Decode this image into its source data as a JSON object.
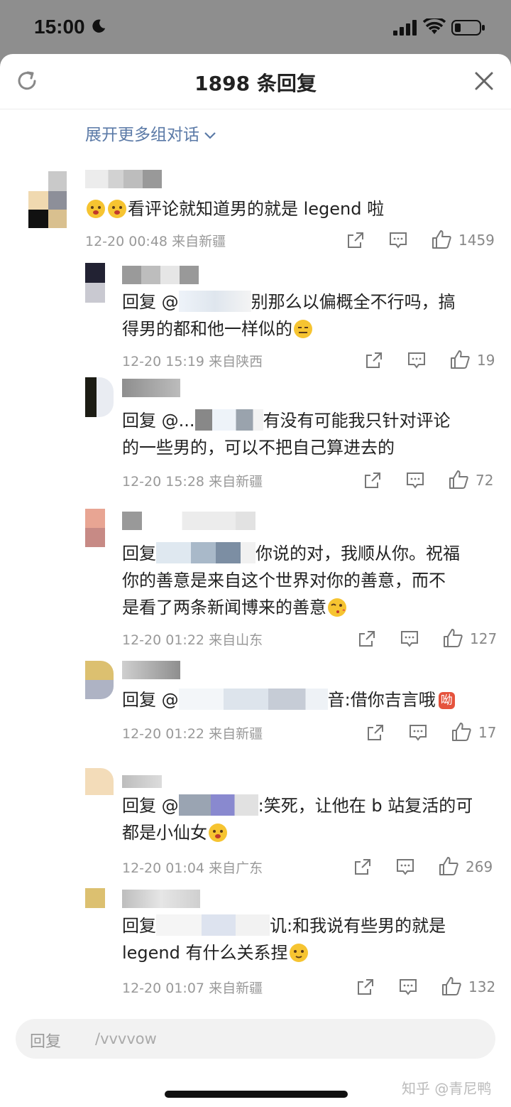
{
  "status_bar": {
    "time": "15:00"
  },
  "sheet": {
    "title": "1898 条回复",
    "expand_link": "展开更多组对话"
  },
  "comments": [
    {
      "text_lines": [
        "看评论就知道男的就是 legend 啦"
      ],
      "time": "12-20 00:48",
      "location": "来自新疆",
      "likes": "1459"
    },
    {
      "text_lines": [
        "回复 @",
        "别那么以偏概全不行吗，搞",
        "得男的都和他一样似的"
      ],
      "time": "12-20 15:19",
      "location": "来自陕西",
      "likes": "19"
    },
    {
      "text_lines": [
        "回复 @...",
        "有没有可能我只针对评论",
        "的一些男的，可以不把自己算进去的"
      ],
      "time": "12-20 15:28",
      "location": "来自新疆",
      "likes": "72"
    },
    {
      "text_lines": [
        "回复",
        "你说的对，我顺从你。祝福",
        "你的善意是来自这个世界对你的善意，而不",
        "是看了两条新闻博来的善意"
      ],
      "time": "12-20 01:22",
      "location": "来自山东",
      "likes": "127"
    },
    {
      "text_lines": [
        "回复 @",
        "音:借你吉言哦",
        "呦"
      ],
      "time": "12-20 01:22",
      "location": "来自新疆",
      "likes": "17"
    },
    {
      "text_lines": [
        "回复 @",
        ":笑死，让他在 b 站复活的可",
        "都是小仙女"
      ],
      "time": "12-20 01:04",
      "location": "来自广东",
      "likes": "269"
    },
    {
      "text_lines": [
        "回复",
        "讥:和我说有些男的就是",
        "legend 有什么关系捏"
      ],
      "time": "12-20 01:07",
      "location": "来自新疆",
      "likes": "132"
    }
  ],
  "reply_bar": {
    "label": "回复",
    "value": "/vvvvow"
  },
  "watermark": "知乎 @青尼鸭",
  "colors": {
    "link": "#5b7aa7",
    "meta": "#999999",
    "text": "#222222",
    "emoji": "#f6c431"
  },
  "icons": [
    "refresh-icon",
    "close-icon",
    "share-icon",
    "comment-icon",
    "like-icon",
    "chevron-down-icon",
    "moon-icon",
    "signal-icon",
    "wifi-icon",
    "battery-icon"
  ]
}
